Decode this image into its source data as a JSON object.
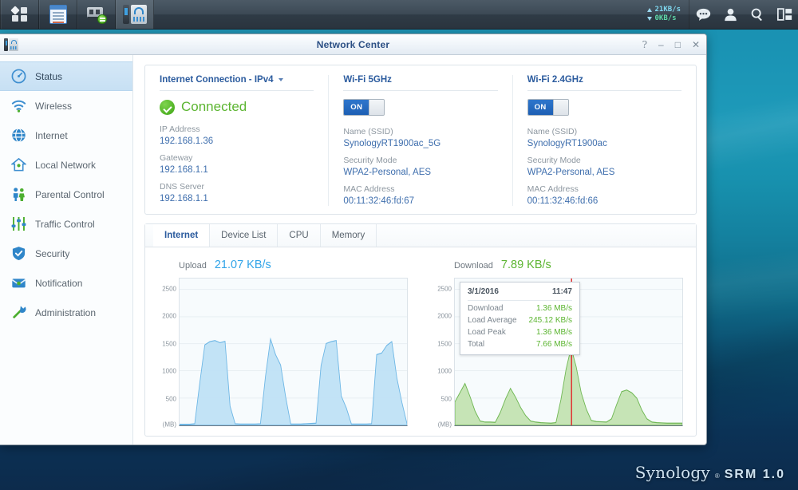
{
  "taskbar": {
    "apps": [
      {
        "name": "main-menu",
        "icon": "grid-menu-icon"
      },
      {
        "name": "package-center",
        "icon": "document-icon"
      },
      {
        "name": "usb-device",
        "icon": "usb-drive-icon"
      },
      {
        "name": "network-center",
        "icon": "router-icon"
      }
    ],
    "speed": {
      "upload": "21KB/s",
      "download": "0KB/s"
    },
    "icons": [
      "notifications-icon",
      "user-icon",
      "search-icon",
      "widgets-icon"
    ]
  },
  "window": {
    "title": "Network Center",
    "controls": {
      "help": "?",
      "minimize": "–",
      "maximize": "□",
      "close": "✕"
    }
  },
  "sidebar": {
    "items": [
      {
        "label": "Status",
        "icon": "gauge-icon",
        "active": true
      },
      {
        "label": "Wireless",
        "icon": "wifi-icon",
        "active": false
      },
      {
        "label": "Internet",
        "icon": "globe-icon",
        "active": false
      },
      {
        "label": "Local Network",
        "icon": "home-icon",
        "active": false
      },
      {
        "label": "Parental Control",
        "icon": "people-icon",
        "active": false
      },
      {
        "label": "Traffic Control",
        "icon": "sliders-icon",
        "active": false
      },
      {
        "label": "Security",
        "icon": "shield-icon",
        "active": false
      },
      {
        "label": "Notification",
        "icon": "envelope-icon",
        "active": false
      },
      {
        "label": "Administration",
        "icon": "tools-icon",
        "active": false
      }
    ]
  },
  "internet_connection": {
    "heading": "Internet Connection - IPv4",
    "status": "Connected",
    "fields": [
      {
        "label": "IP Address",
        "value": "192.168.1.36"
      },
      {
        "label": "Gateway",
        "value": "192.168.1.1"
      },
      {
        "label": "DNS Server",
        "value": "192.168.1.1"
      }
    ]
  },
  "wifi_5ghz": {
    "heading": "Wi-Fi 5GHz",
    "toggle": "ON",
    "fields": [
      {
        "label": "Name (SSID)",
        "value": "SynologyRT1900ac_5G"
      },
      {
        "label": "Security Mode",
        "value": "WPA2-Personal, AES"
      },
      {
        "label": "MAC Address",
        "value": "00:11:32:46:fd:67"
      }
    ]
  },
  "wifi_24ghz": {
    "heading": "Wi-Fi 2.4GHz",
    "toggle": "ON",
    "fields": [
      {
        "label": "Name (SSID)",
        "value": "SynologyRT1900ac"
      },
      {
        "label": "Security Mode",
        "value": "WPA2-Personal, AES"
      },
      {
        "label": "MAC Address",
        "value": "00:11:32:46:fd:66"
      }
    ]
  },
  "tabs": [
    {
      "label": "Internet",
      "active": true
    },
    {
      "label": "Device List",
      "active": false
    },
    {
      "label": "CPU",
      "active": false
    },
    {
      "label": "Memory",
      "active": false
    }
  ],
  "upload": {
    "label": "Upload",
    "value": "21.07 KB/s",
    "color": "#31a4e8"
  },
  "download": {
    "label": "Download",
    "value": "7.89 KB/s",
    "color": "#5cb531"
  },
  "tooltip": {
    "date": "3/1/2016",
    "time": "11:47",
    "rows": [
      {
        "key": "Download",
        "value": "1.36 MB/s"
      },
      {
        "key": "Load Average",
        "value": "245.12 KB/s"
      },
      {
        "key": "Load Peak",
        "value": "1.36 MB/s"
      },
      {
        "key": "Total",
        "value": "7.66 MB/s"
      }
    ]
  },
  "branding": {
    "name": "Synology",
    "reg": "®",
    "product": "SRM 1.0"
  },
  "chart_data": [
    {
      "type": "area",
      "title": "Upload",
      "unit": "(MB)",
      "ylabel": "(MB)",
      "xlabel": "",
      "ylim": [
        0,
        2700
      ],
      "yticks": [
        500,
        1000,
        1500,
        2000,
        2500
      ],
      "grid": true,
      "color": "#a8d8f0",
      "line_color": "#5fb4e5",
      "current_value": "21.07 KB/s",
      "series": [
        {
          "name": "Upload",
          "values": [
            20,
            20,
            20,
            30,
            780,
            1480,
            1540,
            1560,
            1520,
            1545,
            350,
            30,
            25,
            25,
            25,
            25,
            30,
            900,
            1590,
            1300,
            1110,
            520,
            25,
            25,
            25,
            30,
            35,
            40,
            1100,
            1505,
            1540,
            1560,
            540,
            320,
            25,
            25,
            25,
            25,
            30,
            1300,
            1330,
            1470,
            1540,
            870,
            420,
            30
          ]
        }
      ]
    },
    {
      "type": "area",
      "title": "Download",
      "unit": "(MB)",
      "ylabel": "(MB)",
      "xlabel": "",
      "ylim": [
        0,
        2700
      ],
      "yticks": [
        500,
        1000,
        1500,
        2000,
        2500
      ],
      "grid": true,
      "color": "#b4dda2",
      "line_color": "#6bb84e",
      "current_value": "7.89 KB/s",
      "marker_label": "11:47",
      "series": [
        {
          "name": "Download",
          "values": [
            430,
            600,
            770,
            530,
            260,
            80,
            60,
            60,
            55,
            240,
            480,
            680,
            520,
            330,
            180,
            80,
            60,
            50,
            45,
            40,
            50,
            480,
            1030,
            1430,
            1080,
            600,
            300,
            90,
            70,
            65,
            60,
            120,
            380,
            620,
            650,
            600,
            500,
            280,
            120,
            60,
            50,
            45,
            40,
            40,
            40,
            40
          ]
        }
      ]
    }
  ]
}
